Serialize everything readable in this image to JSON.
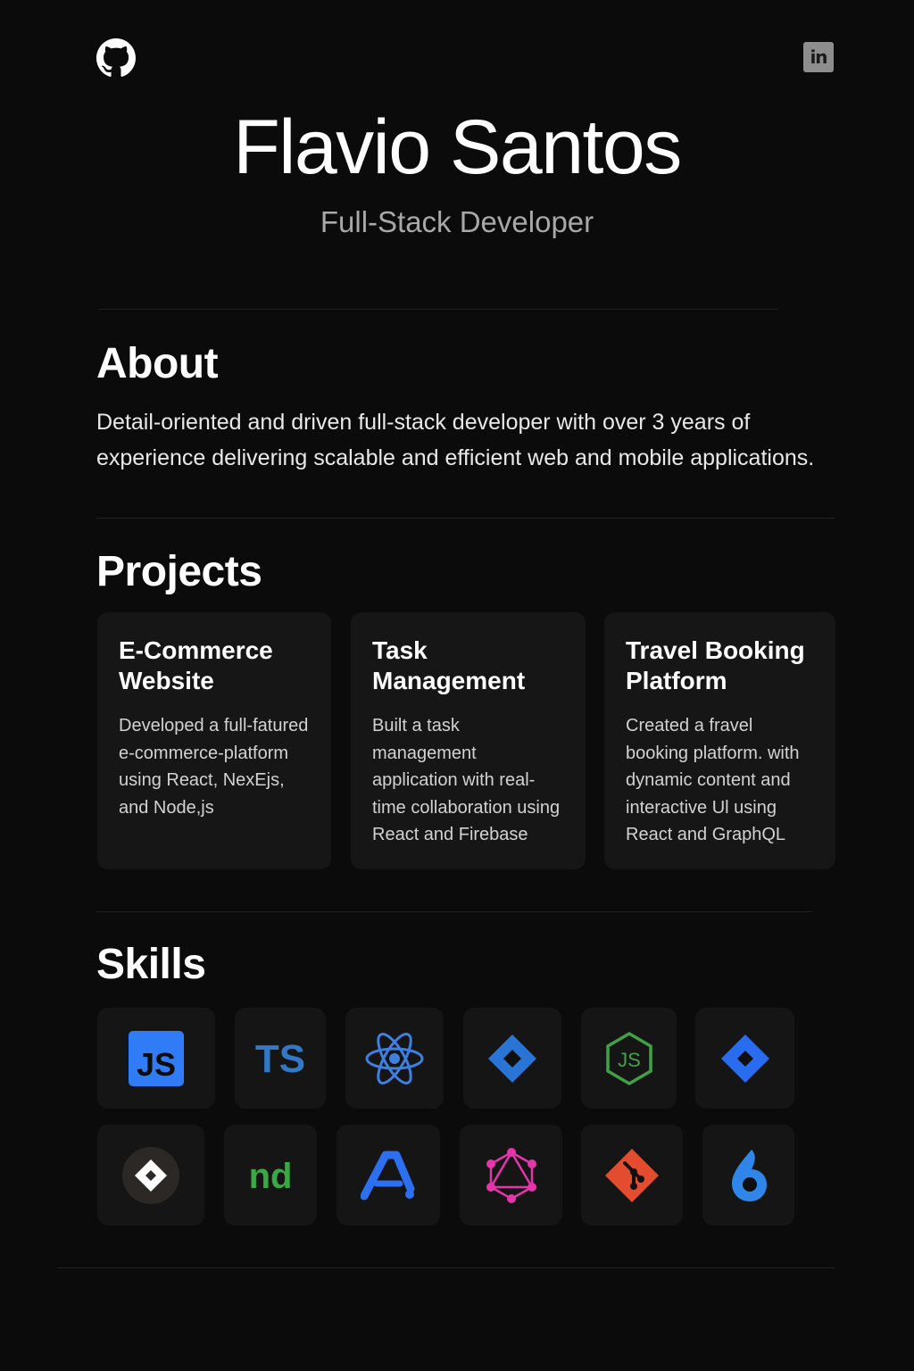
{
  "header": {
    "github_icon": "github-icon",
    "linkedin_icon": "linkedin-icon",
    "linkedin_label": "in",
    "name": "Flavio Santos",
    "role": "Full-Stack Developer"
  },
  "about": {
    "title": "About",
    "text": "Detail-oriented and driven full-stack developer with over 3 years of experience delivering scalable and efficient web and mobile applications."
  },
  "projects": {
    "title": "Projects",
    "items": [
      {
        "title": "E-Commerce Website",
        "description": "Developed a full-fatured e-commerce-platform using React, NexEjs, and Node,js"
      },
      {
        "title": "Task Management",
        "description": "Built a task management application with real- time collaboration using React and Firebase"
      },
      {
        "title": "Travel Booking Platform",
        "description": "Created a fravel booking platform. with dynamic content and interactive Ul using React and GraphQL"
      }
    ]
  },
  "skills": {
    "title": "Skills",
    "row1": [
      {
        "icon": "javascript-icon",
        "label": "JS",
        "color": "#2f7cf6"
      },
      {
        "icon": "typescript-icon",
        "label": "TS",
        "color": "#3178c6"
      },
      {
        "icon": "react-icon",
        "color": "#3f7fe0"
      },
      {
        "icon": "diamond-logo-icon",
        "color": "#2a74d6"
      },
      {
        "icon": "nodejs-icon",
        "label": "JS",
        "color": "#43a047"
      },
      {
        "icon": "jira-icon",
        "color": "#2a6cf0"
      }
    ],
    "row2": [
      {
        "icon": "diamond-badge-icon",
        "color": "#ffffff"
      },
      {
        "icon": "npm-nd-icon",
        "label": "nd",
        "color": "#3aa845"
      },
      {
        "icon": "a-logo-icon",
        "color": "#2c6ff0"
      },
      {
        "icon": "graphql-icon",
        "color": "#e535ab"
      },
      {
        "icon": "git-icon",
        "color": "#e44c30"
      },
      {
        "icon": "drop-logo-icon",
        "color": "#2f86e8"
      }
    ]
  },
  "colors": {
    "background": "#0b0b0b",
    "card": "#161616",
    "divider": "#222222",
    "muted_text": "#a8a8a8"
  }
}
